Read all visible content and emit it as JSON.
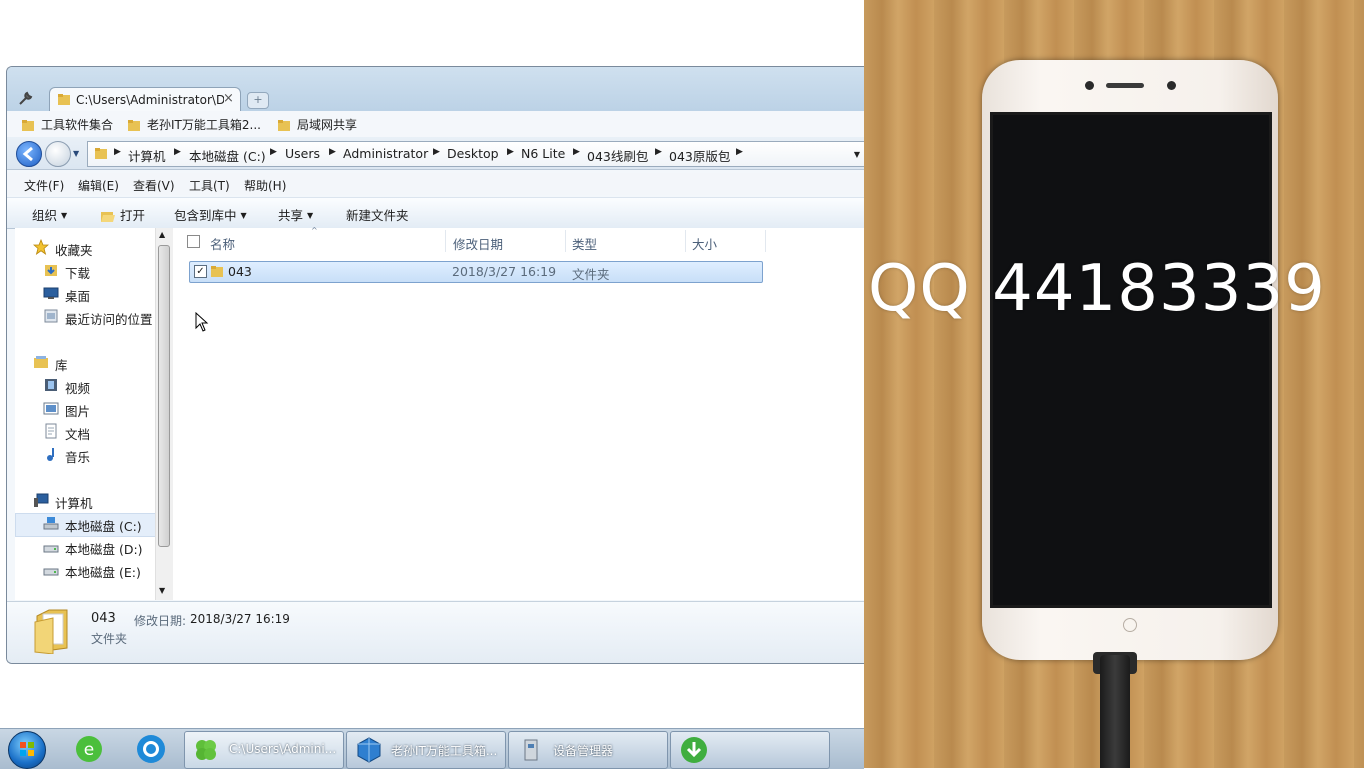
{
  "window": {
    "tab_title": "C:\\Users\\Administrator\\D",
    "tab_close": "×",
    "new_tab": "+"
  },
  "favorites": [
    "工具软件集合",
    "老孙IT万能工具箱2...",
    "局域网共享"
  ],
  "address": {
    "segments": [
      "计算机",
      "本地磁盘 (C:)",
      "Users",
      "Administrator",
      "Desktop",
      "N6 Lite",
      "043线刷包",
      "043原版包"
    ]
  },
  "menu": [
    "文件(F)",
    "编辑(E)",
    "查看(V)",
    "工具(T)",
    "帮助(H)"
  ],
  "toolbar": {
    "organize": "组织",
    "open": "打开",
    "include_library": "包含到库中",
    "share": "共享",
    "new_folder": "新建文件夹"
  },
  "nav": {
    "favorites": "收藏夹",
    "downloads": "下载",
    "desktop": "桌面",
    "recent": "最近访问的位置",
    "libraries": "库",
    "videos": "视频",
    "pictures": "图片",
    "documents": "文档",
    "music": "音乐",
    "computer": "计算机",
    "drive_c": "本地磁盘 (C:)",
    "drive_d": "本地磁盘 (D:)",
    "drive_e": "本地磁盘 (E:)"
  },
  "columns": {
    "name": "名称",
    "modified": "修改日期",
    "type": "类型",
    "size": "大小"
  },
  "row": {
    "name": "043",
    "modified": "2018/3/27 16:19",
    "type": "文件夹",
    "checked": "✓"
  },
  "details": {
    "name": "043",
    "modified_label": "修改日期:",
    "modified_value": "2018/3/27 16:19",
    "type": "文件夹"
  },
  "taskbar": {
    "items": [
      "C:\\Users\\Admini...",
      "老孙IT万能工具箱...",
      "设备管理器"
    ]
  },
  "overlay": {
    "qq": "QQ 44183339"
  },
  "colors": {
    "selection": "#cce4fa",
    "accent": "#1e5fc4"
  }
}
